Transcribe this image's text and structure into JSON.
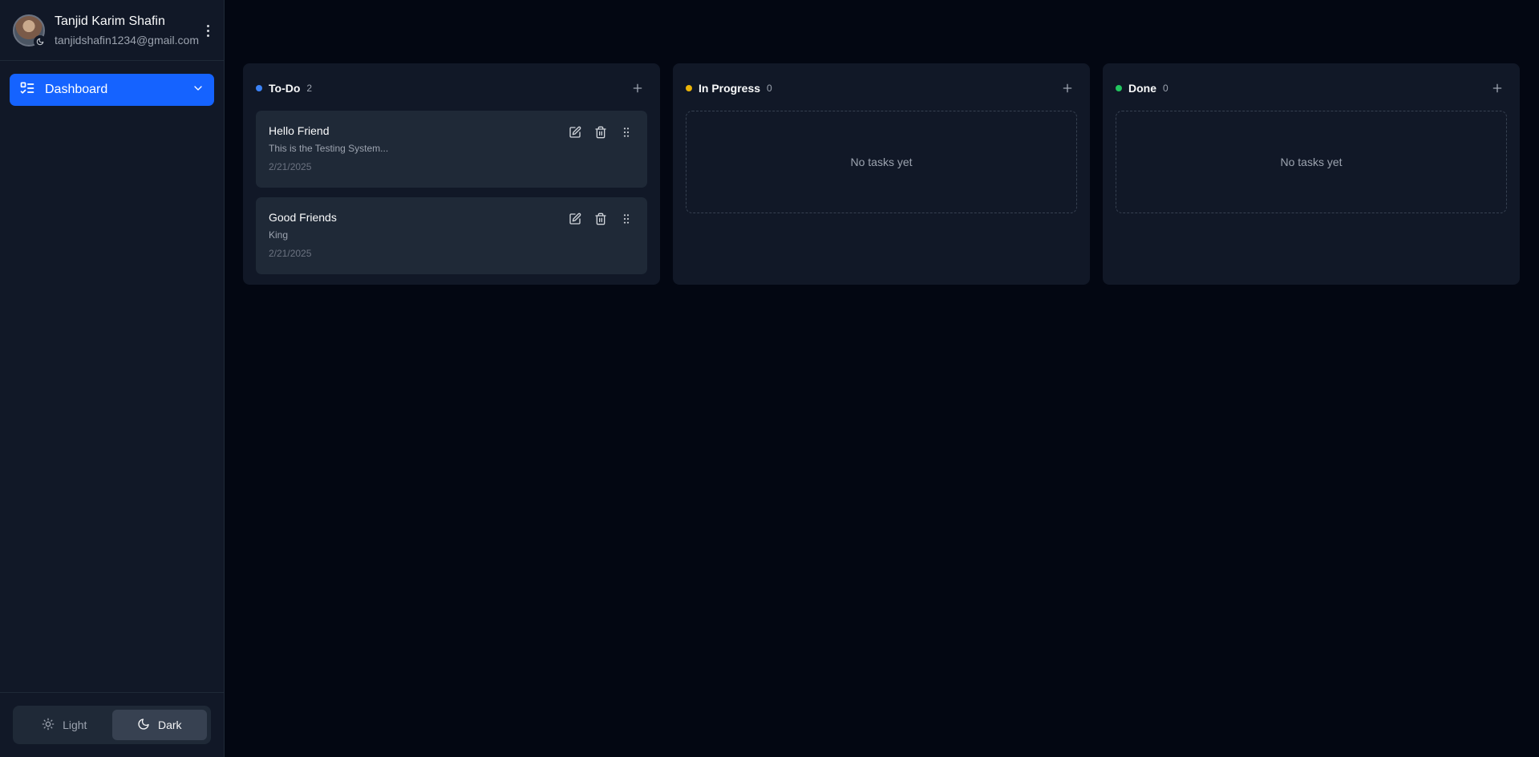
{
  "user": {
    "name": "Tanjid Karim Shafin",
    "email": "tanjidshafin1234@gmail.com"
  },
  "nav": {
    "dashboard_label": "Dashboard"
  },
  "theme": {
    "light_label": "Light",
    "dark_label": "Dark",
    "selected": "Dark"
  },
  "colors": {
    "accent": "#1563ff",
    "todo": "#3b82f6",
    "in_progress": "#eab308",
    "done": "#22c55e"
  },
  "board": {
    "todo": {
      "title": "To-Do",
      "count": "2",
      "cards": [
        {
          "title": "Hello Friend",
          "description": "This is the Testing System...",
          "date": "2/21/2025"
        },
        {
          "title": "Good Friends",
          "description": "King",
          "date": "2/21/2025"
        }
      ]
    },
    "in_progress": {
      "title": "In Progress",
      "count": "0",
      "empty_text": "No tasks yet"
    },
    "done": {
      "title": "Done",
      "count": "0",
      "empty_text": "No tasks yet"
    }
  }
}
